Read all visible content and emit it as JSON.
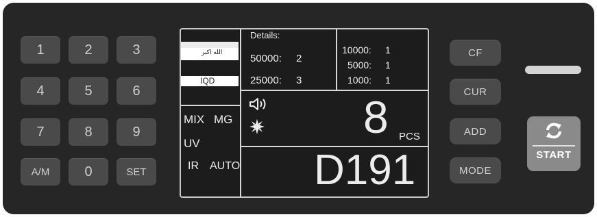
{
  "keypad": {
    "keys": [
      "1",
      "2",
      "3",
      "4",
      "5",
      "6",
      "7",
      "8",
      "9",
      "A/M",
      "0",
      "SET"
    ]
  },
  "right_keys": {
    "cf": "CF",
    "cur": "CUR",
    "add": "ADD",
    "mode": "MODE"
  },
  "start_button": {
    "label": "START",
    "icon": "refresh-icon"
  },
  "display": {
    "flag_text": "الله اكبر",
    "currency": "IQD",
    "details_title": "Details:",
    "details_left": [
      {
        "denom": "50000:",
        "count": "2"
      },
      {
        "denom": "25000:",
        "count": "3"
      }
    ],
    "details_right": [
      {
        "denom": "10000:",
        "count": "1"
      },
      {
        "denom": "5000:",
        "count": "1"
      },
      {
        "denom": "1000:",
        "count": "1"
      }
    ],
    "mode_mix": "MIX",
    "mode_mg": "MG",
    "mode_uv": "UV",
    "mode_ir": "IR",
    "mode_auto": "AUTO",
    "count_value": "8",
    "count_unit": "PCS",
    "total_value": "D191",
    "sound_icon": "speaker-icon",
    "speed_icon": "impeller-icon"
  },
  "colors": {
    "panel": "#262626",
    "key": "#4a4a4a",
    "start": "#8a8a8a",
    "flag_red": "#ffffff",
    "screen": "#1c1c1c"
  }
}
